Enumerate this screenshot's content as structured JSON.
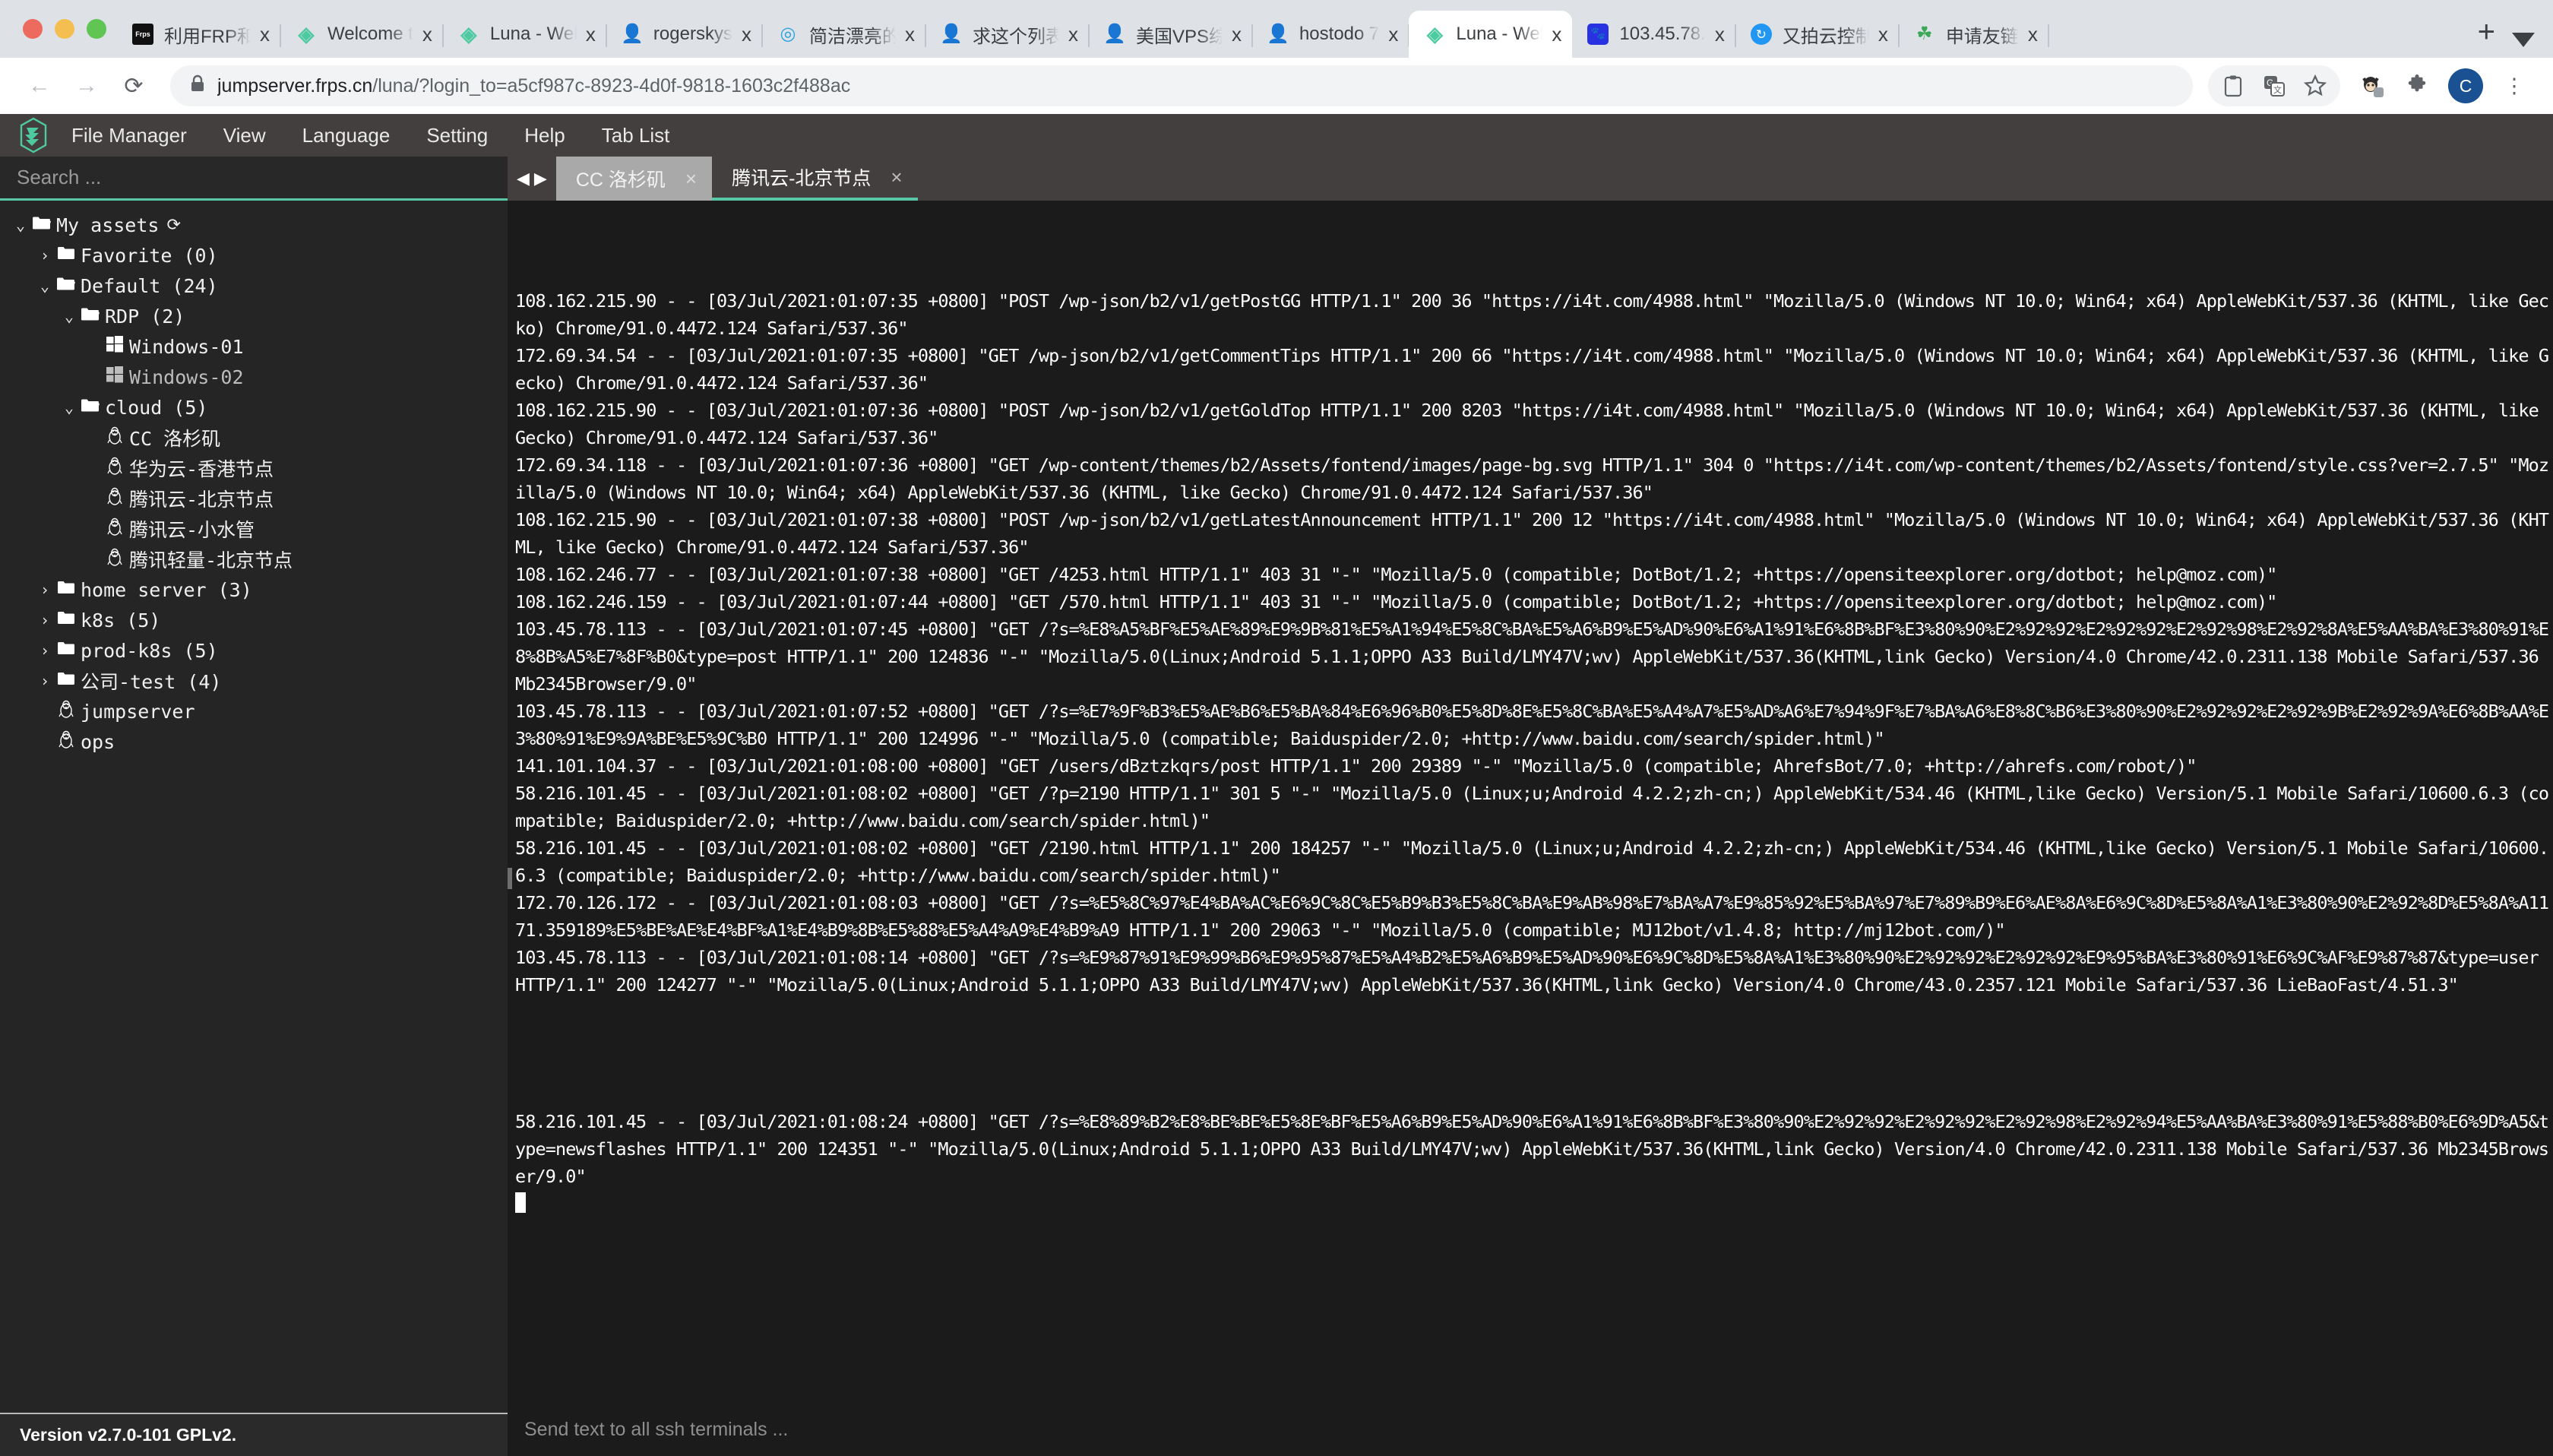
{
  "browser": {
    "tabs": [
      {
        "title": "利用FRP和",
        "favicon": "frps-favicon",
        "close": "x",
        "active": false
      },
      {
        "title": "Welcome t",
        "favicon": "jumpserver-favicon",
        "close": "x",
        "active": false
      },
      {
        "title": "Luna - Wel",
        "favicon": "jumpserver-favicon",
        "close": "x",
        "active": false
      },
      {
        "title": "rogerskys",
        "favicon": "face-favicon",
        "close": "x",
        "active": false
      },
      {
        "title": "简洁漂亮的",
        "favicon": "blue-favicon",
        "close": "x",
        "active": false
      },
      {
        "title": "求这个列表",
        "favicon": "face-favicon",
        "close": "x",
        "active": false
      },
      {
        "title": "美国VPS综",
        "favicon": "face-favicon",
        "close": "x",
        "active": false
      },
      {
        "title": "hostodo 7",
        "favicon": "face-favicon",
        "close": "x",
        "active": false
      },
      {
        "title": "Luna - Wel",
        "favicon": "jumpserver-favicon",
        "close": "x",
        "active": true
      },
      {
        "title": "103.45.78.",
        "favicon": "baidu-favicon",
        "close": "x",
        "active": false
      },
      {
        "title": "又拍云控制",
        "favicon": "upyun-favicon",
        "close": "x",
        "active": false
      },
      {
        "title": "申请友链",
        "favicon": "green-favicon",
        "close": "x",
        "active": false
      }
    ],
    "new_tab_label": "+",
    "toolbar": {
      "back": "←",
      "forward": "→",
      "reload": "⟳",
      "lock": "🔒",
      "url_host": "jumpserver.frps.cn",
      "url_path": "/luna/?login_to=a5cf987c-8923-4d0f-9818-1603c2f488ac",
      "icons": [
        "clipboard-icon",
        "translate-icon",
        "bookmark-star-icon",
        "octocat-extension-icon",
        "extensions-puzzle-icon"
      ],
      "avatar_initial": "C",
      "menu": "⋮"
    }
  },
  "app": {
    "logo": "jumpserver-logo",
    "menu": [
      "File Manager",
      "View",
      "Language",
      "Setting",
      "Help",
      "Tab List"
    ],
    "version": "Version v2.7.0-101 GPLv2."
  },
  "sidebar": {
    "search_placeholder": "Search ...",
    "tree": [
      {
        "depth": 0,
        "arrow": "v",
        "icon": "folder-open",
        "label": "My assets",
        "refresh": "⟳"
      },
      {
        "depth": 1,
        "arrow": ">",
        "icon": "folder",
        "label": "Favorite (0)"
      },
      {
        "depth": 1,
        "arrow": "v",
        "icon": "folder-open",
        "label": "Default (24)"
      },
      {
        "depth": 2,
        "arrow": "v",
        "icon": "folder-open",
        "label": "RDP (2)"
      },
      {
        "depth": 3,
        "arrow": "",
        "icon": "windows",
        "label": "Windows-01"
      },
      {
        "depth": 3,
        "arrow": "",
        "icon": "windows",
        "label": "Windows-02",
        "dim": true
      },
      {
        "depth": 2,
        "arrow": "v",
        "icon": "folder-open",
        "label": "cloud (5)"
      },
      {
        "depth": 3,
        "arrow": "",
        "icon": "linux",
        "label": "CC 洛杉矶"
      },
      {
        "depth": 3,
        "arrow": "",
        "icon": "linux",
        "label": "华为云-香港节点"
      },
      {
        "depth": 3,
        "arrow": "",
        "icon": "linux",
        "label": "腾讯云-北京节点"
      },
      {
        "depth": 3,
        "arrow": "",
        "icon": "linux",
        "label": "腾讯云-小水管"
      },
      {
        "depth": 3,
        "arrow": "",
        "icon": "linux",
        "label": "腾讯轻量-北京节点"
      },
      {
        "depth": 1,
        "arrow": ">",
        "icon": "folder",
        "label": "home server (3)"
      },
      {
        "depth": 1,
        "arrow": ">",
        "icon": "folder",
        "label": "k8s (5)"
      },
      {
        "depth": 1,
        "arrow": ">",
        "icon": "folder",
        "label": "prod-k8s (5)"
      },
      {
        "depth": 1,
        "arrow": ">",
        "icon": "folder",
        "label": "公司-test (4)"
      },
      {
        "depth": 1,
        "arrow": "",
        "icon": "linux",
        "label": "jumpserver"
      },
      {
        "depth": 1,
        "arrow": "",
        "icon": "linux",
        "label": "ops"
      }
    ]
  },
  "terminal_tabs": {
    "nav_left": "◀",
    "nav_right": "▶",
    "tabs": [
      {
        "label": "CC 洛杉矶",
        "close": "×",
        "active": false
      },
      {
        "label": "腾讯云-北京节点",
        "close": "×",
        "active": true
      }
    ]
  },
  "terminal": {
    "lines": [
      "108.162.215.90 - - [03/Jul/2021:01:07:35 +0800] \"POST /wp-json/b2/v1/getPostGG HTTP/1.1\" 200 36 \"https://i4t.com/4988.html\" \"Mozilla/5.0 (Windows NT 10.0; Win64; x64) AppleWebKit/537.36 (KHTML, like Gecko) Chrome/91.0.4472.124 Safari/537.36\"",
      "172.69.34.54 - - [03/Jul/2021:01:07:35 +0800] \"GET /wp-json/b2/v1/getCommentTips HTTP/1.1\" 200 66 \"https://i4t.com/4988.html\" \"Mozilla/5.0 (Windows NT 10.0; Win64; x64) AppleWebKit/537.36 (KHTML, like Gecko) Chrome/91.0.4472.124 Safari/537.36\"",
      "108.162.215.90 - - [03/Jul/2021:01:07:36 +0800] \"POST /wp-json/b2/v1/getGoldTop HTTP/1.1\" 200 8203 \"https://i4t.com/4988.html\" \"Mozilla/5.0 (Windows NT 10.0; Win64; x64) AppleWebKit/537.36 (KHTML, like Gecko) Chrome/91.0.4472.124 Safari/537.36\"",
      "172.69.34.118 - - [03/Jul/2021:01:07:36 +0800] \"GET /wp-content/themes/b2/Assets/fontend/images/page-bg.svg HTTP/1.1\" 304 0 \"https://i4t.com/wp-content/themes/b2/Assets/fontend/style.css?ver=2.7.5\" \"Mozilla/5.0 (Windows NT 10.0; Win64; x64) AppleWebKit/537.36 (KHTML, like Gecko) Chrome/91.0.4472.124 Safari/537.36\"",
      "108.162.215.90 - - [03/Jul/2021:01:07:38 +0800] \"POST /wp-json/b2/v1/getLatestAnnouncement HTTP/1.1\" 200 12 \"https://i4t.com/4988.html\" \"Mozilla/5.0 (Windows NT 10.0; Win64; x64) AppleWebKit/537.36 (KHTML, like Gecko) Chrome/91.0.4472.124 Safari/537.36\"",
      "108.162.246.77 - - [03/Jul/2021:01:07:38 +0800] \"GET /4253.html HTTP/1.1\" 403 31 \"-\" \"Mozilla/5.0 (compatible; DotBot/1.2; +https://opensiteexplorer.org/dotbot; help@moz.com)\"",
      "108.162.246.159 - - [03/Jul/2021:01:07:44 +0800] \"GET /570.html HTTP/1.1\" 403 31 \"-\" \"Mozilla/5.0 (compatible; DotBot/1.2; +https://opensiteexplorer.org/dotbot; help@moz.com)\"",
      "103.45.78.113 - - [03/Jul/2021:01:07:45 +0800] \"GET /?s=%E8%A5%BF%E5%AE%89%E9%9B%81%E5%A1%94%E5%8C%BA%E5%A6%B9%E5%AD%90%E6%A1%91%E6%8B%BF%E3%80%90%E2%92%92%E2%92%92%E2%92%98%E2%92%8A%E5%AA%BA%E3%80%91%E8%8B%A5%E7%8F%B0&type=post HTTP/1.1\" 200 124836 \"-\" \"Mozilla/5.0(Linux;Android 5.1.1;OPPO A33 Build/LMY47V;wv) AppleWebKit/537.36(KHTML,link Gecko) Version/4.0 Chrome/42.0.2311.138 Mobile Safari/537.36 Mb2345Browser/9.0\"",
      "103.45.78.113 - - [03/Jul/2021:01:07:52 +0800] \"GET /?s=%E7%9F%B3%E5%AE%B6%E5%BA%84%E6%96%B0%E5%8D%8E%E5%8C%BA%E5%A4%A7%E5%AD%A6%E7%94%9F%E7%BA%A6%E8%8C%B6%E3%80%90%E2%92%92%E2%92%9B%E2%92%9A%E6%8B%AA%E3%80%91%E9%9A%BE%E5%9C%B0 HTTP/1.1\" 200 124996 \"-\" \"Mozilla/5.0 (compatible; Baiduspider/2.0; +http://www.baidu.com/search/spider.html)\"",
      "141.101.104.37 - - [03/Jul/2021:01:08:00 +0800] \"GET /users/dBztzkqrs/post HTTP/1.1\" 200 29389 \"-\" \"Mozilla/5.0 (compatible; AhrefsBot/7.0; +http://ahrefs.com/robot/)\"",
      "58.216.101.45 - - [03/Jul/2021:01:08:02 +0800] \"GET /?p=2190 HTTP/1.1\" 301 5 \"-\" \"Mozilla/5.0 (Linux;u;Android 4.2.2;zh-cn;) AppleWebKit/534.46 (KHTML,like Gecko) Version/5.1 Mobile Safari/10600.6.3 (compatible; Baiduspider/2.0; +http://www.baidu.com/search/spider.html)\"",
      "58.216.101.45 - - [03/Jul/2021:01:08:02 +0800] \"GET /2190.html HTTP/1.1\" 200 184257 \"-\" \"Mozilla/5.0 (Linux;u;Android 4.2.2;zh-cn;) AppleWebKit/534.46 (KHTML,like Gecko) Version/5.1 Mobile Safari/10600.6.3 (compatible; Baiduspider/2.0; +http://www.baidu.com/search/spider.html)\"",
      "172.70.126.172 - - [03/Jul/2021:01:08:03 +0800] \"GET /?s=%E5%8C%97%E4%BA%AC%E6%9C%8C%E5%B9%B3%E5%8C%BA%E9%AB%98%E7%BA%A7%E9%85%92%E5%BA%97%E7%89%B9%E6%AE%8A%E6%9C%8D%E5%8A%A1%E3%80%90%E2%92%8D%E5%8A%A1171.359189%E5%BE%AE%E4%BF%A1%E4%B9%8B%E5%88%E5%A4%A9%E4%B9%A9 HTTP/1.1\" 200 29063 \"-\" \"Mozilla/5.0 (compatible; MJ12bot/v1.4.8; http://mj12bot.com/)\"",
      "103.45.78.113 - - [03/Jul/2021:01:08:14 +0800] \"GET /?s=%E9%87%91%E9%99%B6%E9%95%87%E5%A4%B2%E5%A6%B9%E5%AD%90%E6%9C%8D%E5%8A%A1%E3%80%90%E2%92%92%E2%92%92%E9%95%BA%E3%80%91%E6%9C%AF%E9%87%87&type=user HTTP/1.1\" 200 124277 \"-\" \"Mozilla/5.0(Linux;Android 5.1.1;OPPO A33 Build/LMY47V;wv) AppleWebKit/537.36(KHTML,link Gecko) Version/4.0 Chrome/43.0.2357.121 Mobile Safari/537.36 LieBaoFast/4.51.3\"",
      "",
      "",
      "",
      "",
      "58.216.101.45 - - [03/Jul/2021:01:08:24 +0800] \"GET /?s=%E8%89%B2%E8%BE%BE%E5%8E%BF%E5%A6%B9%E5%AD%90%E6%A1%91%E6%8B%BF%E3%80%90%E2%92%92%E2%92%92%E2%92%98%E2%92%94%E5%AA%BA%E3%80%91%E5%88%B0%E6%9D%A5&type=newsflashes HTTP/1.1\" 200 124351 \"-\" \"Mozilla/5.0(Linux;Android 5.1.1;OPPO A33 Build/LMY47V;wv) AppleWebKit/537.36(KHTML,link Gecko) Version/4.0 Chrome/42.0.2311.138 Mobile Safari/537.36 Mb2345Browser/9.0\""
    ],
    "cursor": "block-cursor",
    "send_placeholder": "Send text to all ssh terminals ..."
  }
}
